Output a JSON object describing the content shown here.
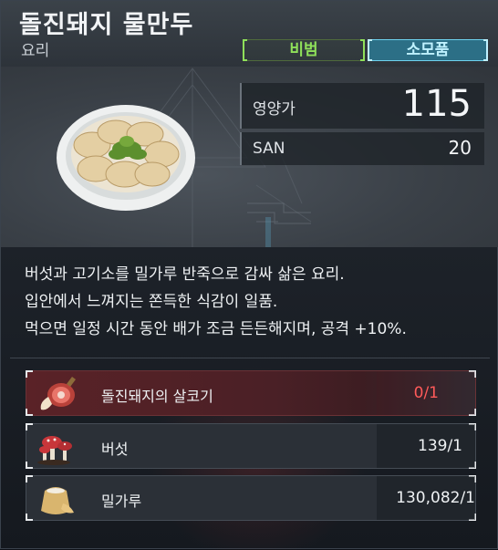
{
  "item": {
    "title": "돌진돼지 물만두",
    "category": "요리",
    "tags": [
      {
        "label": "비범",
        "color": "#8fe05a"
      },
      {
        "label": "소모품",
        "color": "#bff1ff"
      }
    ]
  },
  "stats": {
    "nutrition_label": "영양가",
    "nutrition_value": "115",
    "san_label": "SAN",
    "san_value": "20"
  },
  "description": [
    "버섯과 고기소를 밀가루 반죽으로 감싸 삶은 요리.",
    "입안에서 느껴지는 쫀득한 식감이 일품.",
    "먹으면 일정 시간 동안 배가 조금 든든해지며, 공격 +10%."
  ],
  "ingredients": [
    {
      "name": "돌진돼지의 살코기",
      "qty": "0/1",
      "icon": "meat-icon",
      "insufficient": true
    },
    {
      "name": "버섯",
      "qty": "139/1",
      "icon": "mushroom-icon",
      "insufficient": false
    },
    {
      "name": "밀가루",
      "qty": "130,082/1",
      "icon": "flour-sack-icon",
      "insufficient": false
    }
  ],
  "colors": {
    "rarity_green": "#8fe05a",
    "consumable_blue": "#2c6f86",
    "insufficient_red": "#ff5a5a"
  }
}
